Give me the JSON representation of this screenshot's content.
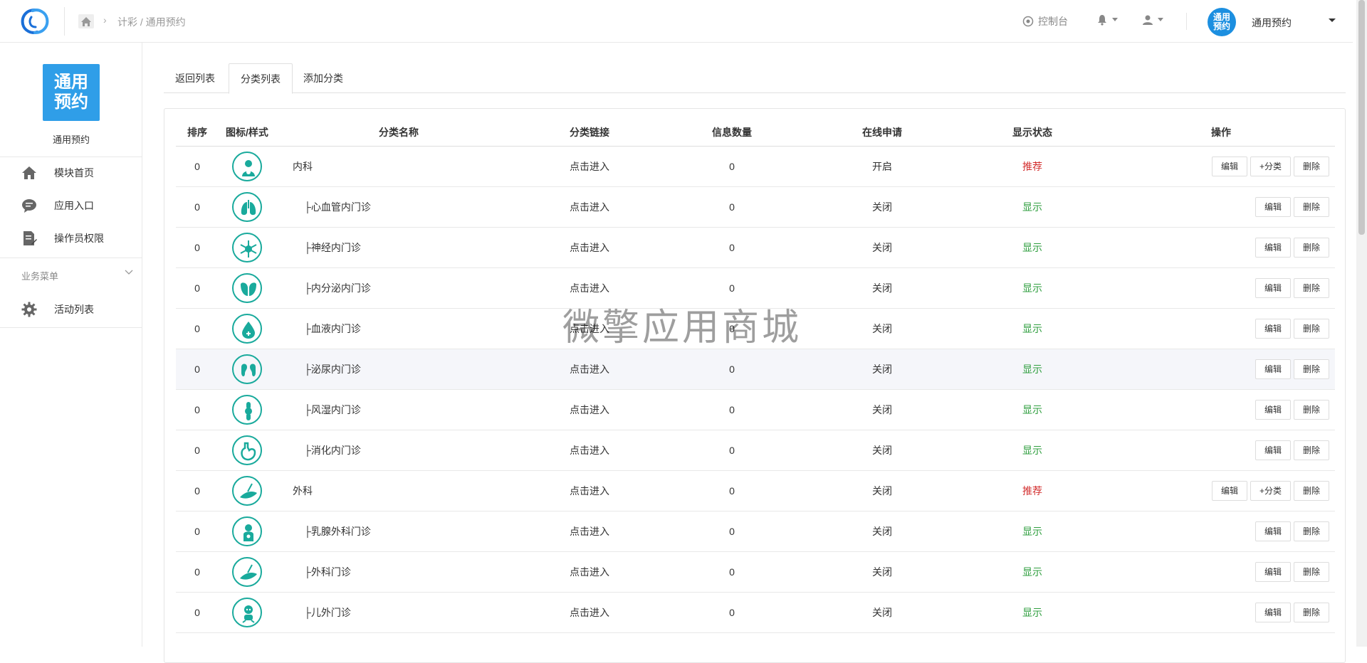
{
  "breadcrumb": "计彩 / 通用预约",
  "header": {
    "console_label": "控制台",
    "avatar_text": "通用\n预约",
    "user_name": "通用预约"
  },
  "sidebar": {
    "logo_text": "通用\n预约",
    "app_name": "通用预约",
    "items": [
      {
        "label": "模块首页",
        "icon": "home-icon"
      },
      {
        "label": "应用入口",
        "icon": "chat-icon"
      },
      {
        "label": "操作员权限",
        "icon": "document-edit-icon"
      }
    ],
    "group_label": "业务菜单",
    "group_items": [
      {
        "label": "活动列表",
        "icon": "gear-icon"
      }
    ]
  },
  "tabs": [
    {
      "label": "返回列表",
      "active": false
    },
    {
      "label": "分类列表",
      "active": true
    },
    {
      "label": "添加分类",
      "active": false
    }
  ],
  "table": {
    "headers": [
      "排序",
      "图标/样式",
      "分类名称",
      "分类链接",
      "信息数量",
      "在线申请",
      "显示状态",
      "操作"
    ],
    "link_text": "点击进入",
    "btn_edit": "编辑",
    "btn_add_sub": "+分类",
    "btn_delete": "删除",
    "rows": [
      {
        "order": "0",
        "icon": "internal-medicine-icon",
        "name": "内科",
        "count": "0",
        "apply": "开启",
        "status": "推荐",
        "top": true
      },
      {
        "order": "0",
        "icon": "lungs-icon",
        "name": "├心血管内门诊",
        "count": "0",
        "apply": "关闭",
        "status": "显示",
        "top": false
      },
      {
        "order": "0",
        "icon": "neuron-icon",
        "name": "├神经内门诊",
        "count": "0",
        "apply": "关闭",
        "status": "显示",
        "top": false
      },
      {
        "order": "0",
        "icon": "endocrine-icon",
        "name": "├内分泌内门诊",
        "count": "0",
        "apply": "关闭",
        "status": "显示",
        "top": false
      },
      {
        "order": "0",
        "icon": "blood-drop-icon",
        "name": "├血液内门诊",
        "count": "0",
        "apply": "关闭",
        "status": "显示",
        "top": false
      },
      {
        "order": "0",
        "icon": "kidney-icon",
        "name": "├泌尿内门诊",
        "count": "0",
        "apply": "关闭",
        "status": "显示",
        "top": false,
        "highlight": true
      },
      {
        "order": "0",
        "icon": "joint-icon",
        "name": "├风湿内门诊",
        "count": "0",
        "apply": "关闭",
        "status": "显示",
        "top": false
      },
      {
        "order": "0",
        "icon": "stomach-icon",
        "name": "├消化内门诊",
        "count": "0",
        "apply": "关闭",
        "status": "显示",
        "top": false
      },
      {
        "order": "0",
        "icon": "scalpel-icon",
        "name": "外科",
        "count": "0",
        "apply": "关闭",
        "status": "推荐",
        "top": true
      },
      {
        "order": "0",
        "icon": "breast-icon",
        "name": "├乳腺外科门诊",
        "count": "0",
        "apply": "关闭",
        "status": "显示",
        "top": false
      },
      {
        "order": "0",
        "icon": "scalpel-icon",
        "name": "├外科门诊",
        "count": "0",
        "apply": "关闭",
        "status": "显示",
        "top": false
      },
      {
        "order": "0",
        "icon": "child-icon",
        "name": "├儿外门诊",
        "count": "0",
        "apply": "关闭",
        "status": "显示",
        "top": false
      }
    ]
  },
  "watermark": "微擎应用商城",
  "colors": {
    "accent": "#19aa9c",
    "recommend": "#d32f2f",
    "show": "#2e9e3e",
    "brand": "#2f9ee8"
  }
}
